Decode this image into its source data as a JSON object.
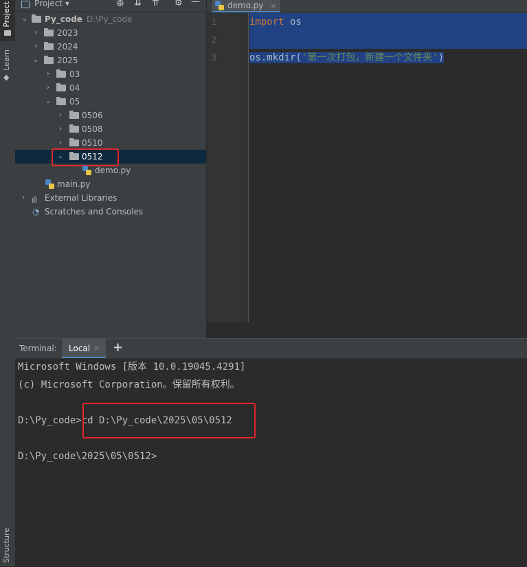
{
  "sidebar": {
    "project_label": "Project",
    "learn_label": "Learn",
    "structure_label": "Structure"
  },
  "project": {
    "header_label": "Project",
    "tree": {
      "root_name": "Py_code",
      "root_path": "D:\\Py_code",
      "folders": [
        "2023",
        "2024",
        "2025",
        "03",
        "04",
        "05",
        "0506",
        "0508",
        "0510",
        "0512"
      ],
      "demo_file": "demo.py",
      "main_file": "main.py",
      "external_libraries": "External Libraries",
      "scratches": "Scratches and Consoles"
    }
  },
  "editor": {
    "tab_label": "demo.py",
    "line_numbers": [
      "1",
      "2",
      "3"
    ],
    "line1_kw": "import",
    "line1_rest": " os",
    "line3_call": "os.mkdir(",
    "line3_str": "'第一次打包，新建一个文件夹'",
    "line3_close": ")"
  },
  "terminal": {
    "title": "Terminal:",
    "tab_label": "Local",
    "lines": [
      "Microsoft Windows [版本 10.0.19045.4291]",
      "(c) Microsoft Corporation。保留所有权利。",
      "D:\\Py_code>",
      "cd D:\\Py_code\\2025\\05\\0512",
      "D:\\Py_code\\2025\\05\\0512>"
    ]
  },
  "colors": {
    "selection": "#214283",
    "keyword": "#cc7832",
    "string": "#6a8759",
    "highlight_box": "#e2262b"
  }
}
